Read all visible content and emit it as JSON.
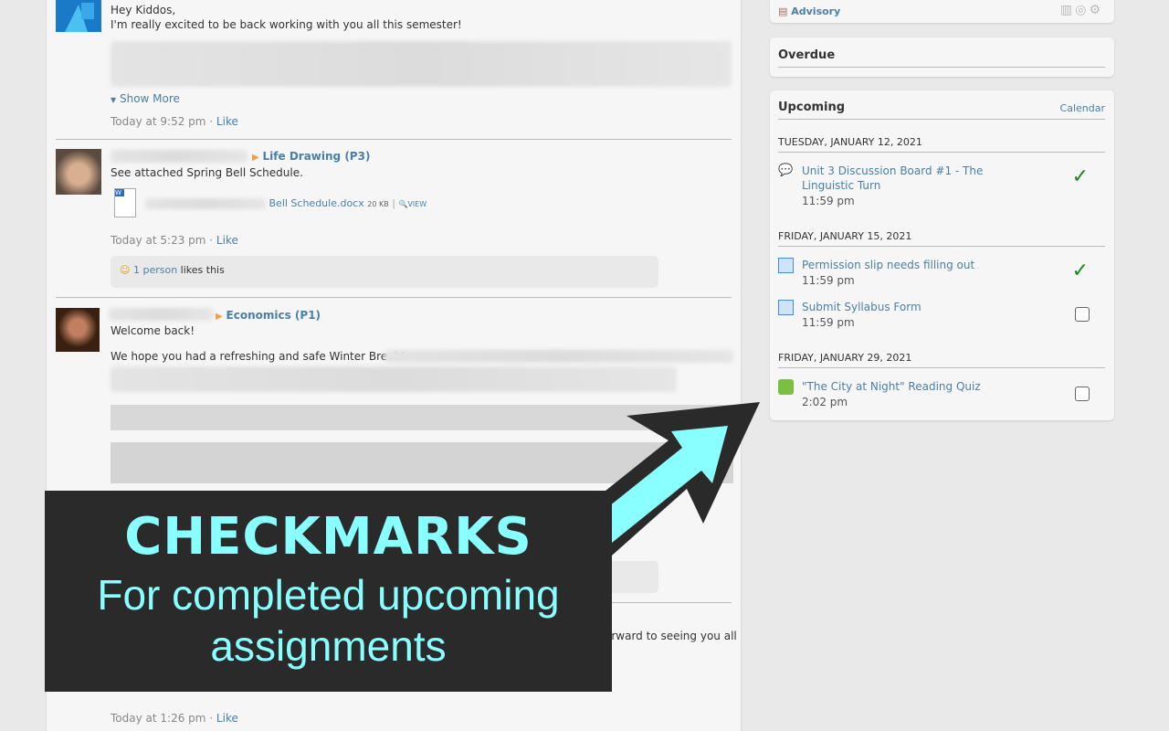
{
  "feed": {
    "post1": {
      "greeting": "Hey Kiddos,",
      "text": "I'm really excited to be back working with you all this semester!",
      "show_more": "Show More",
      "time": "Today at 9:52 pm",
      "like": "Like"
    },
    "post2": {
      "course": "Life Drawing (P3)",
      "text": "See attached Spring Bell Schedule.",
      "file": "Bell Schedule.docx",
      "size": "20 KB",
      "view": "VIEW",
      "time": "Today at 5:23 pm",
      "like": "Like",
      "likes_link": "1 person",
      "likes_text": "likes this"
    },
    "post3": {
      "course": "Economics (P1)",
      "greeting": "Welcome back!",
      "text": "We hope you had a refreshing and safe Winter Break!"
    },
    "post4": {
      "partial": "orward to seeing you all",
      "time": "Today at 1:26 pm",
      "like": "Like"
    }
  },
  "sidebar": {
    "advisory": "Advisory",
    "overdue": "Overdue",
    "upcoming": {
      "title": "Upcoming",
      "calendar": "Calendar",
      "groups": [
        {
          "date": "TUESDAY, JANUARY 12, 2021",
          "items": [
            {
              "title": "Unit 3 Discussion Board #1 - The Linguistic Turn",
              "time": "11:59 pm",
              "icon": "discussion-icon",
              "completed": true
            }
          ]
        },
        {
          "date": "FRIDAY, JANUARY 15, 2021",
          "items": [
            {
              "title": "Permission slip needs filling out",
              "time": "11:59 pm",
              "icon": "assignment-icon",
              "completed": true
            },
            {
              "title": "Submit Syllabus Form",
              "time": "11:59 pm",
              "icon": "assignment-icon",
              "completed": false
            }
          ]
        },
        {
          "date": "FRIDAY, JANUARY 29, 2021",
          "items": [
            {
              "title": "\"The City at Night\" Reading Quiz",
              "time": "2:02 pm",
              "icon": "quiz-icon",
              "completed": false
            }
          ]
        }
      ]
    }
  },
  "overlay": {
    "headline": "CHECKMARKS",
    "subline": "For completed upcoming assignments",
    "color": "#8affff"
  }
}
